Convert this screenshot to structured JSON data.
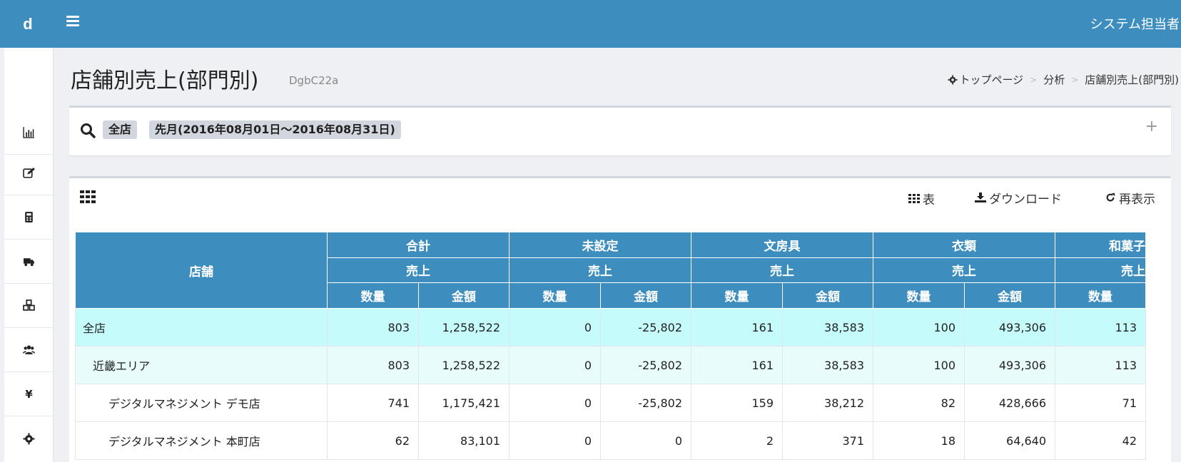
{
  "app": {
    "brand": "d",
    "user": "システム担当者"
  },
  "sidebar": {
    "icons": [
      "chart-icon",
      "edit-icon",
      "calculator-icon",
      "truck-icon",
      "cubes-icon",
      "users-icon",
      "yen-icon",
      "gear-icon"
    ],
    "yen_glyph": "¥"
  },
  "page": {
    "title": "店舗別売上(部門別)",
    "code": "DgbC22a"
  },
  "breadcrumb": {
    "items": [
      "トップページ",
      "分析",
      "店舗別売上(部門別)"
    ],
    "separator": ">"
  },
  "filter": {
    "chips": [
      "全店",
      "先月(2016年08月01日～2016年08月31日)"
    ],
    "expand": "+"
  },
  "tabs": {
    "table": "表",
    "download": "ダウンロード",
    "refresh": "再表示"
  },
  "table": {
    "store_header": "店舗",
    "groups": [
      "合計",
      "未設定",
      "文房具",
      "衣類",
      "和菓子"
    ],
    "sub": "売上",
    "qty": "数量",
    "amt": "金額",
    "rows": [
      {
        "name": "全店",
        "level": 0,
        "cells": [
          "803",
          "1,258,522",
          "0",
          "-25,802",
          "161",
          "38,583",
          "100",
          "493,306",
          "113"
        ]
      },
      {
        "name": "近畿エリア",
        "level": 1,
        "cells": [
          "803",
          "1,258,522",
          "0",
          "-25,802",
          "161",
          "38,583",
          "100",
          "493,306",
          "113"
        ]
      },
      {
        "name": "デジタルマネジメント デモ店",
        "level": 2,
        "cells": [
          "741",
          "1,175,421",
          "0",
          "-25,802",
          "159",
          "38,212",
          "82",
          "428,666",
          "71"
        ]
      },
      {
        "name": "デジタルマネジメント 本町店",
        "level": 2,
        "cells": [
          "62",
          "83,101",
          "0",
          "0",
          "2",
          "371",
          "18",
          "64,640",
          "42"
        ]
      }
    ]
  },
  "colors": {
    "primary": "#3d8ebf",
    "row_total": "#c6fbfb",
    "row_area": "#e8fdfb"
  }
}
